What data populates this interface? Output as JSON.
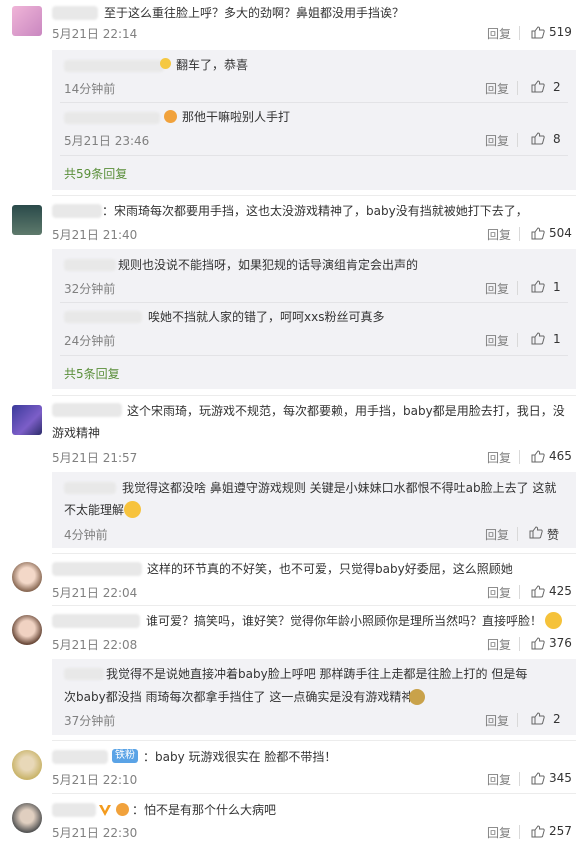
{
  "comments": [
    {
      "text": "至于这么重往脸上呼？多大的劲啊？鼻姐都没用手挡诶？",
      "time": "5月21日 22:14",
      "reply_label": "回复",
      "likes": "519",
      "subs": [
        {
          "text": "翻车了，恭喜",
          "time": "14分钟前",
          "reply_label": "回复",
          "likes": "2"
        },
        {
          "text": "那他干嘛啦别人手打",
          "time": "5月21日 23:46",
          "reply_label": "回复",
          "likes": "8"
        }
      ],
      "more": "共59条回复"
    },
    {
      "text": "：宋雨琦每次都要用手挡，这也太没游戏精神了，baby没有挡就被她打下去了，",
      "time": "5月21日 21:40",
      "reply_label": "回复",
      "likes": "504",
      "subs": [
        {
          "text": "规则也没说不能挡呀，如果犯规的话导演组肯定会出声的",
          "time": "32分钟前",
          "reply_label": "回复",
          "likes": "1"
        },
        {
          "text": "唉她不挡就人家的错了，呵呵xxs粉丝可真多",
          "time": "24分钟前",
          "reply_label": "回复",
          "likes": "1"
        }
      ],
      "more": "共5条回复"
    },
    {
      "text_line1": "这个宋雨琦，玩游戏不规范，每次都要赖，用手挡，baby都是用脸去打，我日，没",
      "text_line2": "游戏精神",
      "time": "5月21日 21:57",
      "reply_label": "回复",
      "likes": "465",
      "subs": [
        {
          "text_line1": "我觉得这都没啥 鼻姐遵守游戏规则 关键是小妹妹口水都恨不得吐ab脸上去了 这就",
          "text_line2": "不太能理解",
          "time": "4分钟前",
          "reply_label": "回复",
          "likes": "赞"
        }
      ]
    },
    {
      "text": "这样的环节真的不好笑，也不可爱，只觉得baby好委屈，这么照顾她",
      "time": "5月21日 22:04",
      "reply_label": "回复",
      "likes": "425"
    },
    {
      "text": "谁可爱？搞笑吗，谁好笑？觉得你年龄小照顾你是理所当然吗？直接呼脸！",
      "time": "5月21日 22:08",
      "reply_label": "回复",
      "likes": "376",
      "subs": [
        {
          "text_line1": "我觉得不是说她直接冲着baby脸上呼吧 那样踌手往上走都是往脸上打的 但是每",
          "text_line2": "次baby都没挡 雨琦每次都拿手挡住了 这一点确实是没有游戏精神",
          "time": "37分钟前",
          "reply_label": "回复",
          "likes": "2"
        }
      ]
    },
    {
      "badge": "铁粉",
      "text": "baby 玩游戏很实在 脸都不带挡！",
      "time": "5月21日 22:10",
      "reply_label": "回复",
      "likes": "345"
    },
    {
      "text": "：怕不是有那个什么大病吧",
      "time": "5月21日 22:30",
      "reply_label": "回复",
      "likes": "257"
    }
  ],
  "colors": {
    "accent_green": "#5a8f3a",
    "subbox_bg": "#f2f2f5",
    "time_gray": "#808080"
  }
}
